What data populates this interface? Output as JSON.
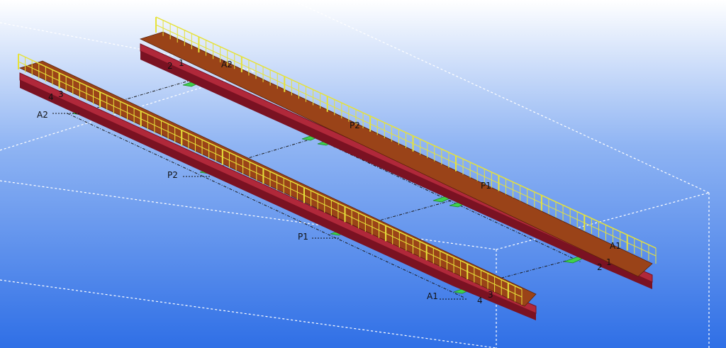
{
  "scene": {
    "colors": {
      "sky_top": "#ffffff",
      "sky_mid": "#8fb4f3",
      "sky_bottom": "#2f6fe6",
      "girder": "#b0283a",
      "girder_dark": "#7a1222",
      "deck": "#9a4318",
      "deck_edge": "#5a230b",
      "railing": "#e6e23a",
      "bearing": "#3fd14c",
      "bearing_dark": "#1e8a2c",
      "dash_white": "#ffffff",
      "dash_black": "#1a1a1a"
    }
  },
  "labels": {
    "left_bridge": {
      "a2": "A2",
      "p2": "P2",
      "p1": "P1",
      "a1": "A1",
      "g4_start": "4",
      "g3_start": "3",
      "g4_end": "4",
      "g3_end": "3"
    },
    "right_bridge": {
      "a2": "A2",
      "p2": "P2",
      "p1": "P1",
      "a1": "A1",
      "g2_start": "2",
      "g1_start": "1",
      "g2_end": "2",
      "g1_end": "1"
    }
  }
}
